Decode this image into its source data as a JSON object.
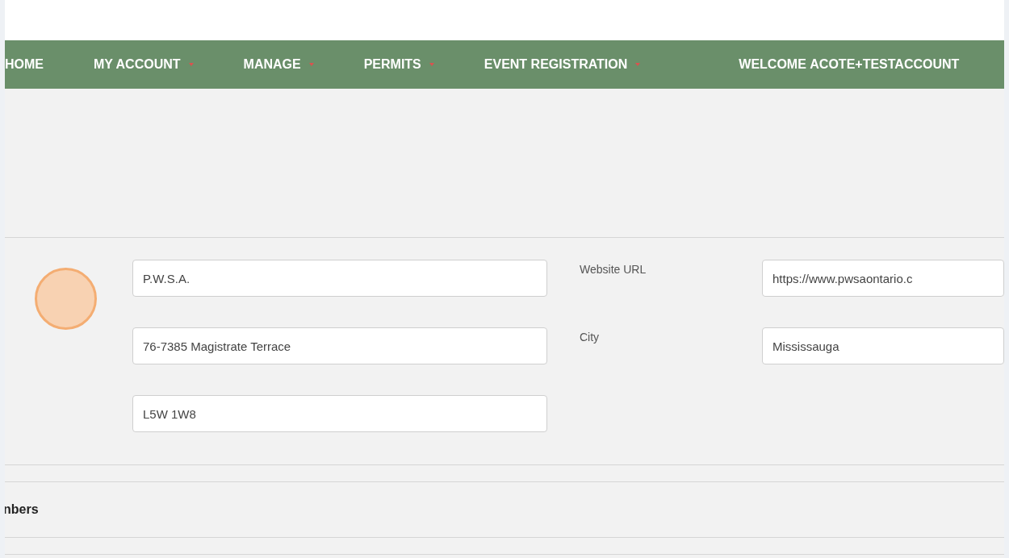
{
  "nav": {
    "items": [
      {
        "label": "HOME",
        "has_menu": false
      },
      {
        "label": "MY ACCOUNT",
        "has_menu": true
      },
      {
        "label": "MANAGE",
        "has_menu": true
      },
      {
        "label": "PERMITS",
        "has_menu": true
      },
      {
        "label": "EVENT REGISTRATION",
        "has_menu": true
      }
    ],
    "welcome": "WELCOME **ACOTE+TESTACCOUNT**"
  },
  "form": {
    "left_fields": [
      {
        "value": "P.W.S.A."
      },
      {
        "value": "76-7385 Magistrate Terrace"
      },
      {
        "value": "L5W 1W8"
      }
    ],
    "right_fields": [
      {
        "label": "Website URL",
        "value": "https://www.pwsaontario.c"
      },
      {
        "label": "City",
        "value": "Mississauga"
      }
    ]
  },
  "section_heading": "nbers"
}
